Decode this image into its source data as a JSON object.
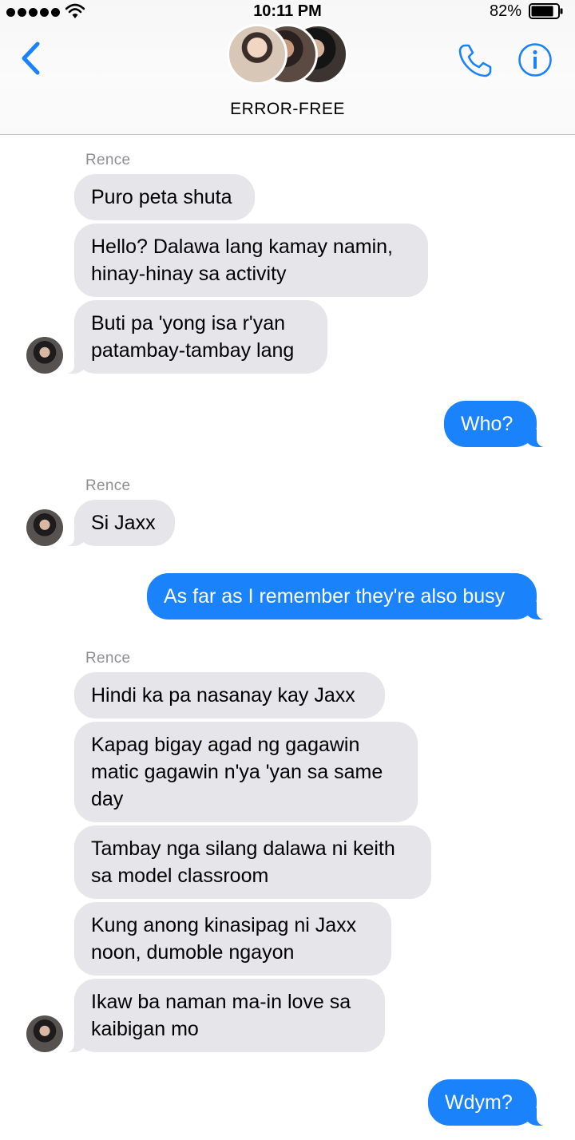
{
  "status_bar": {
    "time": "10:11 PM",
    "battery_percent": "82%",
    "battery_level": 0.82,
    "signal_bars": 5
  },
  "header": {
    "title": "ERROR-FREE",
    "back_icon": "chevron-left-icon",
    "call_icon": "phone-icon",
    "info_icon": "info-icon",
    "accent_color": "#1a82fb"
  },
  "messages": [
    {
      "sender": "Rence",
      "text": "Puro peta shuta"
    },
    {
      "text": "Hello? Dalawa lang kamay namin, hinay-hinay sa activity"
    },
    {
      "text": "Buti pa 'yong isa r'yan patambay-tambay lang"
    },
    {
      "text": "Who?"
    },
    {
      "sender": "Rence",
      "text": "Si Jaxx"
    },
    {
      "text": "As far as I remember they're also busy"
    },
    {
      "sender": "Rence",
      "text": "Hindi ka pa nasanay kay Jaxx"
    },
    {
      "text": "Kapag bigay agad ng gagawin matic gagawin n'ya 'yan sa same day"
    },
    {
      "text": "Tambay nga silang dalawa ni keith sa model classroom"
    },
    {
      "text": "Kung anong kinasipag ni Jaxx noon, dumoble ngayon"
    },
    {
      "text": "Ikaw ba naman ma-in love sa kaibigan mo"
    },
    {
      "text": "Wdym?"
    }
  ],
  "colors": {
    "incoming_bubble": "#e5e5ea",
    "outgoing_bubble": "#1a82fb",
    "sender_label": "#8e8e93"
  }
}
